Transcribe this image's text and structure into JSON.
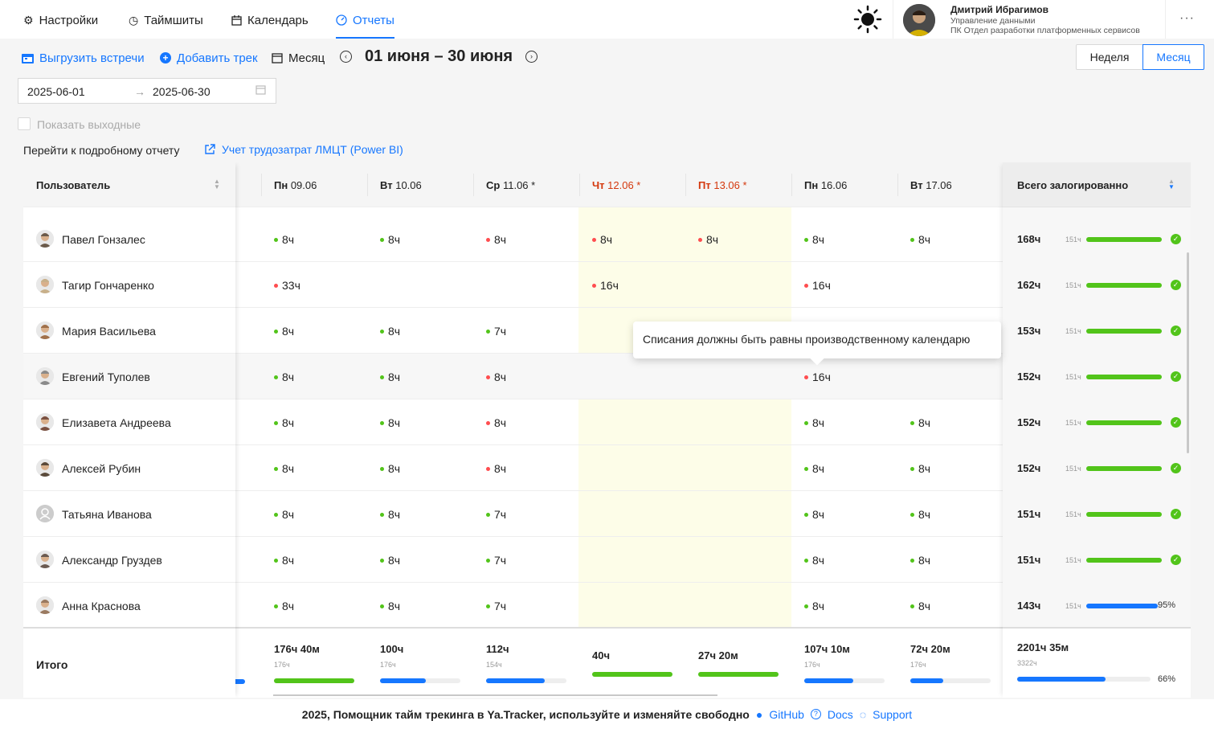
{
  "nav": {
    "settings": "Настройки",
    "timesheets": "Таймшиты",
    "calendar": "Календарь",
    "reports": "Отчеты"
  },
  "user": {
    "name": "Дмитрий Ибрагимов",
    "dept1": "Управление данными",
    "dept2": "ПК Отдел разработки платформенных сервисов",
    "more": "···"
  },
  "toolbar": {
    "export_meetings": "Выгрузить встречи",
    "add_track": "Добавить трек",
    "month": "Месяц",
    "period": "01 июня – 30 июня",
    "week_btn": "Неделя",
    "month_btn": "Месяц"
  },
  "range": {
    "start": "2025-06-01",
    "end": "2025-06-30",
    "arrow": "→"
  },
  "show_weekends": "Показать выходные",
  "goto_label": "Перейти к подробному отчету",
  "goto_link": "Учет трудозатрат ЛМЦТ (Power BI)",
  "table": {
    "user_header": "Пользователь",
    "total_header": "Всего залогированно",
    "days": [
      {
        "wd": "Пн",
        "date": "09.06",
        "red": false
      },
      {
        "wd": "Вт",
        "date": "10.06",
        "red": false
      },
      {
        "wd": "Ср",
        "date": "11.06 *",
        "red": false
      },
      {
        "wd": "Чт",
        "date": "12.06 *",
        "red": true
      },
      {
        "wd": "Пт",
        "date": "13.06 *",
        "red": true
      },
      {
        "wd": "Пн",
        "date": "16.06",
        "red": false
      },
      {
        "wd": "Вт",
        "date": "17.06",
        "red": false
      }
    ],
    "rows": [
      {
        "name": "Павел Гонзалес",
        "cells": [
          [
            "8ч",
            "g"
          ],
          [
            "8ч",
            "g"
          ],
          [
            "8ч",
            "r"
          ],
          [
            "8ч",
            "r"
          ],
          [
            "8ч",
            "r"
          ],
          [
            "8ч",
            "g"
          ],
          [
            "8ч",
            "g"
          ]
        ],
        "total": "168ч",
        "norm": "151ч",
        "fill": 1.0,
        "status": "ok"
      },
      {
        "name": "Тагир Гончаренко",
        "cells": [
          [
            "33ч",
            "r"
          ],
          null,
          null,
          [
            "16ч",
            "r"
          ],
          null,
          [
            "16ч",
            "r"
          ],
          null
        ],
        "total": "162ч",
        "norm": "151ч",
        "fill": 1.0,
        "status": "ok"
      },
      {
        "name": "Мария Васильева",
        "cells": [
          [
            "8ч",
            "g"
          ],
          [
            "8ч",
            "g"
          ],
          [
            "7ч",
            "g"
          ],
          null,
          null,
          null,
          null
        ],
        "total": "153ч",
        "norm": "151ч",
        "fill": 1.0,
        "status": "ok"
      },
      {
        "name": "Евгений Туполев",
        "cells": [
          [
            "8ч",
            "g"
          ],
          [
            "8ч",
            "g"
          ],
          [
            "8ч",
            "r"
          ],
          null,
          null,
          [
            "16ч",
            "r"
          ],
          null
        ],
        "total": "152ч",
        "norm": "151ч",
        "fill": 1.0,
        "status": "ok"
      },
      {
        "name": "Елизавета Андреева",
        "cells": [
          [
            "8ч",
            "g"
          ],
          [
            "8ч",
            "g"
          ],
          [
            "8ч",
            "r"
          ],
          null,
          null,
          [
            "8ч",
            "g"
          ],
          [
            "8ч",
            "g"
          ]
        ],
        "total": "152ч",
        "norm": "151ч",
        "fill": 1.0,
        "status": "ok"
      },
      {
        "name": "Алексей Рубин",
        "cells": [
          [
            "8ч",
            "g"
          ],
          [
            "8ч",
            "g"
          ],
          [
            "8ч",
            "r"
          ],
          null,
          null,
          [
            "8ч",
            "g"
          ],
          [
            "8ч",
            "g"
          ]
        ],
        "total": "152ч",
        "norm": "151ч",
        "fill": 1.0,
        "status": "ok"
      },
      {
        "name": "Татьяна Иванова",
        "cells": [
          [
            "8ч",
            "g"
          ],
          [
            "8ч",
            "g"
          ],
          [
            "7ч",
            "g"
          ],
          null,
          null,
          [
            "8ч",
            "g"
          ],
          [
            "8ч",
            "g"
          ]
        ],
        "total": "151ч",
        "norm": "151ч",
        "fill": 1.0,
        "status": "ok"
      },
      {
        "name": "Александр Груздев",
        "cells": [
          [
            "8ч",
            "g"
          ],
          [
            "8ч",
            "g"
          ],
          [
            "7ч",
            "g"
          ],
          null,
          null,
          [
            "8ч",
            "g"
          ],
          [
            "8ч",
            "g"
          ]
        ],
        "total": "151ч",
        "norm": "151ч",
        "fill": 1.0,
        "status": "ok"
      },
      {
        "name": "Анна Краснова",
        "cells": [
          [
            "8ч",
            "g"
          ],
          [
            "8ч",
            "g"
          ],
          [
            "7ч",
            "g"
          ],
          null,
          null,
          [
            "8ч",
            "g"
          ],
          [
            "8ч",
            "g"
          ]
        ],
        "total": "143ч",
        "norm": "151ч",
        "fill": 0.95,
        "status": "95%"
      }
    ],
    "footer_label": "Итого",
    "footer": [
      {
        "value": "176ч 40м",
        "norm": "176ч",
        "fill": 1.0,
        "color": "#52c41a"
      },
      {
        "value": "100ч",
        "norm": "176ч",
        "fill": 0.57,
        "color": "#1677ff"
      },
      {
        "value": "112ч",
        "norm": "154ч",
        "fill": 0.73,
        "color": "#1677ff"
      },
      {
        "value": "40ч",
        "norm": "",
        "fill": 1.0,
        "color": "#52c41a"
      },
      {
        "value": "27ч 20м",
        "norm": "",
        "fill": 1.0,
        "color": "#52c41a"
      },
      {
        "value": "107ч 10м",
        "norm": "176ч",
        "fill": 0.61,
        "color": "#1677ff"
      },
      {
        "value": "72ч 20м",
        "norm": "176ч",
        "fill": 0.41,
        "color": "#1677ff"
      }
    ],
    "grand_total": {
      "value": "2201ч 35м",
      "norm": "3322ч",
      "fill": 0.66,
      "pct": "66%"
    }
  },
  "tooltip": "Списания должны быть равны производственному календарю",
  "footer": {
    "text": "2025, Помощник тайм трекинга в Ya.Tracker, используйте и изменяйте свободно",
    "github": "GitHub",
    "docs": "Docs",
    "support": "Support"
  },
  "colors": {
    "accent": "#1677ff",
    "green": "#52c41a",
    "red": "#ff4d4f",
    "weekend_bg": "#fdfde8"
  }
}
